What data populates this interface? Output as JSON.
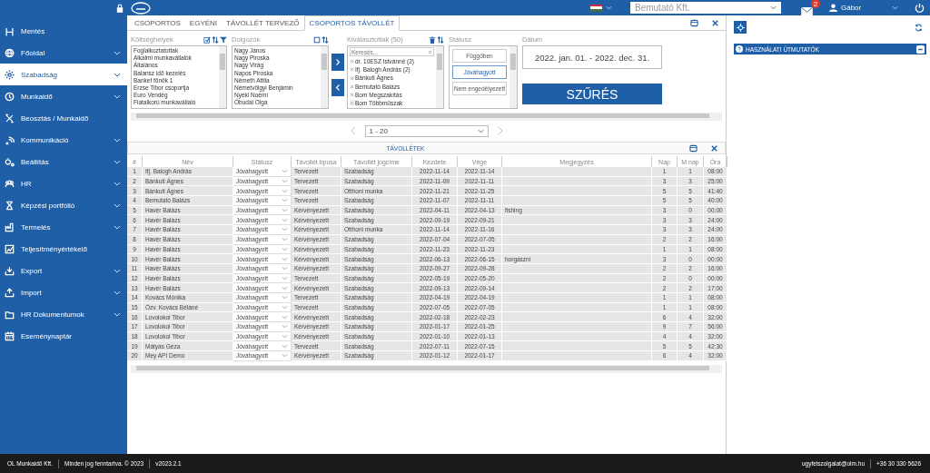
{
  "top_bar": {
    "company": "Bemutató Kft.",
    "mail_badge": "2",
    "user": "Gábor"
  },
  "sidebar": {
    "items": [
      {
        "label": "Mentés",
        "has_submenu": false,
        "selected": false
      },
      {
        "label": "Főoldal",
        "has_submenu": true,
        "selected": false
      },
      {
        "label": "Szabadság",
        "has_submenu": true,
        "selected": true
      },
      {
        "label": "Munkaidő",
        "has_submenu": true,
        "selected": false
      },
      {
        "label": "Beosztás / Munkaidő",
        "has_submenu": false,
        "selected": false
      },
      {
        "label": "Kommunikáció",
        "has_submenu": true,
        "selected": false
      },
      {
        "label": "Beállítás",
        "has_submenu": true,
        "selected": false
      },
      {
        "label": "HR",
        "has_submenu": true,
        "selected": false
      },
      {
        "label": "Képzési portfólió",
        "has_submenu": true,
        "selected": false
      },
      {
        "label": "Termelés",
        "has_submenu": true,
        "selected": false
      },
      {
        "label": "Teljesítményértékelő",
        "has_submenu": false,
        "selected": false
      },
      {
        "label": "Export",
        "has_submenu": true,
        "selected": false
      },
      {
        "label": "Import",
        "has_submenu": true,
        "selected": false
      },
      {
        "label": "HR Dokumentumok",
        "has_submenu": true,
        "selected": false
      },
      {
        "label": "Eseménynaptár",
        "has_submenu": false,
        "selected": false
      }
    ]
  },
  "tabs": [
    {
      "label": "CSOPORTOS",
      "selected": false
    },
    {
      "label": "EGYÉNI",
      "selected": false
    },
    {
      "label": "TÁVOLLÉT TERVEZŐ",
      "selected": false
    },
    {
      "label": "CSOPORTOS TÁVOLLÉT",
      "selected": true
    }
  ],
  "filters": {
    "cost_centers": {
      "label": "Költséghelyek",
      "items": [
        "Foglalkoztatottak",
        "Alkalmi munkavállalók",
        "Általános",
        "Balansz idő kezelés",
        "Banket főnök 1",
        "Erzse Tibor csoportja",
        "Euro Vendég",
        "Fiatalkorú munkavállaló"
      ]
    },
    "employees": {
      "label": "Dolgozók",
      "items": [
        "Nagy János",
        "Nagy Piroska",
        "Nagy Virág",
        "Napos Piroska",
        "Németh Attila",
        "Németvölgyi Benjámin",
        "Nyéki Noémi",
        "Óbudai Olga"
      ]
    },
    "chosen": {
      "label": "Kiválasztottak (50)",
      "placeholder": "Keresés...",
      "items": [
        "dr. 10ESZ Istvánné (2)",
        "Ifj. Balogh András (2)",
        "Bánkuti Ágnes",
        "Bemutató Balázs",
        "Bom Megszakítás",
        "Bom Többműszak"
      ]
    },
    "status": {
      "label": "Státusz",
      "items": [
        {
          "label": "Függőben",
          "selected": false
        },
        {
          "label": "Jóváhagyott",
          "selected": true
        },
        {
          "label": "Nem engedélyezett",
          "selected": false
        }
      ]
    },
    "date": {
      "label": "Dátum",
      "value": "2022. jan. 01. - 2022. dec. 31."
    },
    "filter_button": "SZŰRÉS"
  },
  "pager": {
    "value": "1 - 20"
  },
  "table": {
    "title": "TÁVOLLÉTEK",
    "columns": [
      "#",
      "Név",
      "Státusz",
      "Távollét típusa",
      "Távollét jogcíme",
      "Kezdete",
      "Vége",
      "Megjegyzés",
      "Nap",
      "M nap",
      "Óra"
    ],
    "rows": [
      {
        "num": "1",
        "name": "Ifj. Balogh András",
        "status": "Jóváhagyott",
        "type": "Tervezett",
        "reason": "Szabadság",
        "start": "2022-11-14",
        "end": "2022-11-14",
        "days": "1",
        "workdays": "1",
        "hours": "08:00"
      },
      {
        "num": "2",
        "name": "Bánkuti Ágnes",
        "status": "Jóváhagyott",
        "type": "Tervezett",
        "reason": "Szabadság",
        "start": "2022-11-09",
        "end": "2022-11-11",
        "days": "3",
        "workdays": "3",
        "hours": "25:00"
      },
      {
        "num": "3",
        "name": "Bánkuti Ágnes",
        "status": "Jóváhagyott",
        "type": "Tervezett",
        "reason": "Otthoni munka",
        "start": "2022-11-21",
        "end": "2022-11-25",
        "days": "5",
        "workdays": "5",
        "hours": "41:40"
      },
      {
        "num": "4",
        "name": "Bemutató Balázs",
        "status": "Jóváhagyott",
        "type": "Tervezett",
        "reason": "Szabadság",
        "start": "2022-11-07",
        "end": "2022-11-11",
        "days": "5",
        "workdays": "5",
        "hours": "40:00"
      },
      {
        "num": "5",
        "name": "Havér Balázs",
        "status": "Jóváhagyott",
        "type": "Kérvényezett",
        "reason": "Szabadság",
        "start": "2022-04-11",
        "end": "2022-04-13",
        "note": "fishing",
        "days": "3",
        "workdays": "0",
        "hours": "00:00"
      },
      {
        "num": "6",
        "name": "Havér Balázs",
        "status": "Jóváhagyott",
        "type": "Kérvényezett",
        "reason": "Szabadság",
        "start": "2022-09-19",
        "end": "2022-09-21",
        "days": "3",
        "workdays": "3",
        "hours": "24:00"
      },
      {
        "num": "7",
        "name": "Havér Balázs",
        "status": "Jóváhagyott",
        "type": "Kérvényezett",
        "reason": "Otthoni munka",
        "start": "2022-11-14",
        "end": "2022-11-16",
        "days": "3",
        "workdays": "3",
        "hours": "24:00"
      },
      {
        "num": "8",
        "name": "Havér Balázs",
        "status": "Jóváhagyott",
        "type": "Kérvényezett",
        "reason": "Szabadság",
        "start": "2022-07-04",
        "end": "2022-07-05",
        "days": "2",
        "workdays": "2",
        "hours": "16:00"
      },
      {
        "num": "9",
        "name": "Havér Balázs",
        "status": "Jóváhagyott",
        "type": "Kérvényezett",
        "reason": "Szabadság",
        "start": "2022-11-23",
        "end": "2022-11-23",
        "days": "1",
        "workdays": "1",
        "hours": "08:00"
      },
      {
        "num": "10",
        "name": "Havér Balázs",
        "status": "Jóváhagyott",
        "type": "Kérvényezett",
        "reason": "Szabadság",
        "start": "2022-06-13",
        "end": "2022-06-15",
        "note": "horgászni",
        "days": "3",
        "workdays": "0",
        "hours": "00:00"
      },
      {
        "num": "11",
        "name": "Havér Balázs",
        "status": "Jóváhagyott",
        "type": "Kérvényezett",
        "reason": "Szabadság",
        "start": "2022-09-27",
        "end": "2022-09-28",
        "days": "2",
        "workdays": "2",
        "hours": "16:00"
      },
      {
        "num": "12",
        "name": "Havér Balázs",
        "status": "Jóváhagyott",
        "type": "Tervezett",
        "reason": "Szabadság",
        "start": "2022-05-19",
        "end": "2022-05-20",
        "days": "2",
        "workdays": "0",
        "hours": "00:00"
      },
      {
        "num": "13",
        "name": "Havér Balázs",
        "status": "Jóváhagyott",
        "type": "Kérvényezett",
        "reason": "Szabadság",
        "start": "2022-09-13",
        "end": "2022-09-14",
        "days": "2",
        "workdays": "2",
        "hours": "17:00"
      },
      {
        "num": "14",
        "name": "Kovács Mónika",
        "status": "Jóváhagyott",
        "type": "Tervezett",
        "reason": "Szabadság",
        "start": "2022-04-19",
        "end": "2022-04-19",
        "days": "1",
        "workdays": "1",
        "hours": "08:00"
      },
      {
        "num": "15",
        "name": "Özv. Kovács Béláné",
        "status": "Jóváhagyott",
        "type": "Tervezett",
        "reason": "Szabadság",
        "start": "2022-07-05",
        "end": "2022-07-05",
        "days": "1",
        "workdays": "1",
        "hours": "08:00"
      },
      {
        "num": "16",
        "name": "Lovolokoi Tibor",
        "status": "Jóváhagyott",
        "type": "Kérvényezett",
        "reason": "Szabadság",
        "start": "2022-02-18",
        "end": "2022-02-23",
        "days": "6",
        "workdays": "4",
        "hours": "32:00"
      },
      {
        "num": "17",
        "name": "Lovolokoi Tibor",
        "status": "Jóváhagyott",
        "type": "Kérvényezett",
        "reason": "Szabadság",
        "start": "2022-01-17",
        "end": "2022-01-25",
        "days": "9",
        "workdays": "7",
        "hours": "56:00"
      },
      {
        "num": "18",
        "name": "Lovolokoi Tibor",
        "status": "Jóváhagyott",
        "type": "Kérvényezett",
        "reason": "Szabadság",
        "start": "2022-01-10",
        "end": "2022-01-13",
        "days": "4",
        "workdays": "4",
        "hours": "32:00"
      },
      {
        "num": "19",
        "name": "Mátyás Géza",
        "status": "Jóváhagyott",
        "type": "Tervezett",
        "reason": "Szabadság",
        "start": "2022-07-11",
        "end": "2022-07-15",
        "days": "5",
        "workdays": "5",
        "hours": "42:30"
      },
      {
        "num": "20",
        "name": "Mey API Demo",
        "status": "Jóváhagyott",
        "type": "Kérvényezett",
        "reason": "Szabadság",
        "start": "2022-01-12",
        "end": "2022-01-17",
        "days": "6",
        "workdays": "4",
        "hours": "32:00"
      }
    ]
  },
  "right_panel": {
    "section": "HASZNÁLATI ÚTMUTATÓK"
  },
  "footer": {
    "company": "OL Munkaidő Kft.",
    "rights": "Minden jog fenntartva. © 2023",
    "version": "v2023.2.1",
    "email": "ugyfelszolgalat@olm.hu",
    "phone": "+36 30 330 5626"
  }
}
